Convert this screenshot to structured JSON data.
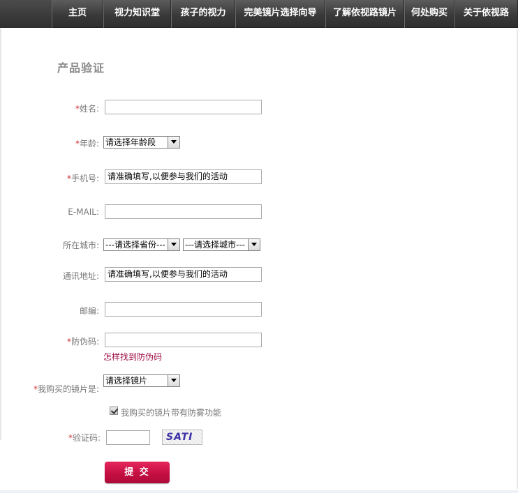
{
  "nav": {
    "items": [
      "主页",
      "视力知识堂",
      "孩子的视力",
      "完美镜片选择向导",
      "了解依视路镜片",
      "何处购买",
      "关于依视路"
    ]
  },
  "page": {
    "title": "产品验证"
  },
  "form": {
    "required_mark": "*",
    "name": {
      "label": "姓名:",
      "value": ""
    },
    "age": {
      "label": "年龄:",
      "selected": "请选择年龄段"
    },
    "phone": {
      "label": "手机号:",
      "value": "请准确填写,以便参与我们的活动"
    },
    "email": {
      "label": "E-MAIL:",
      "value": ""
    },
    "city": {
      "label": "所在城市:",
      "province_selected": "---请选择省份---",
      "city_selected": "---请选择城市---"
    },
    "address": {
      "label": "通讯地址:",
      "value": "请准确填写,以便参与我们的活动"
    },
    "postcode": {
      "label": "邮编:",
      "value": ""
    },
    "anti_fake": {
      "label": "防伪码:",
      "value": "",
      "help_link": "怎样找到防伪码"
    },
    "lens": {
      "label": "我购买的镜片是:",
      "selected": "请选择镜片"
    },
    "anti_fog": {
      "label": "我购买的镜片带有防雾功能",
      "checked": true
    },
    "captcha": {
      "label": "验证码:",
      "value": "",
      "image_text": "SATI"
    },
    "submit_label": "提 交"
  },
  "colors": {
    "required": "#cc3333",
    "link": "#a0124a",
    "submit": "#c20e41"
  }
}
